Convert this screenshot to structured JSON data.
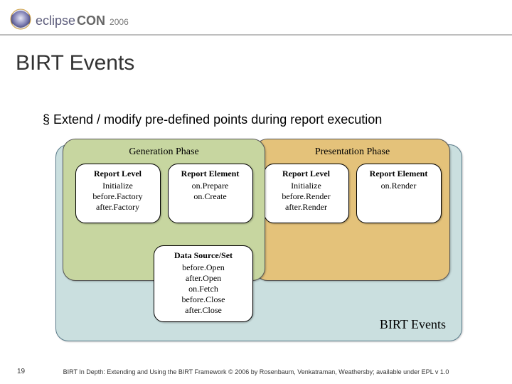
{
  "logo": {
    "ec": "ec",
    "lipse": "lipse",
    "con": "CON",
    "year": "2006"
  },
  "title": "BIRT Events",
  "bullet_marker": "§",
  "bullet_text": "Extend / modify  pre-defined points during report execution",
  "diagram": {
    "generation_title": "Generation Phase",
    "presentation_title": "Presentation Phase",
    "gen_boxes": [
      {
        "title": "Report Level",
        "lines": [
          "Initialize",
          "before.Factory",
          "after.Factory"
        ]
      },
      {
        "title": "Report Element",
        "lines": [
          "on.Prepare",
          "on.Create"
        ]
      }
    ],
    "pres_boxes": [
      {
        "title": "Report Level",
        "lines": [
          "Initialize",
          "before.Render",
          "after.Render"
        ]
      },
      {
        "title": "Report Element",
        "lines": [
          "on.Render"
        ]
      }
    ],
    "data_box": {
      "title": "Data Source/Set",
      "lines": [
        "before.Open",
        "after.Open",
        "on.Fetch",
        "before.Close",
        "after.Close"
      ]
    },
    "events_label": "BIRT Events"
  },
  "page_number": "19",
  "footer": "BIRT In Depth: Extending and Using the BIRT Framework © 2006 by Rosenbaum, Venkatraman, Weathersby; available under EPL v 1.0"
}
